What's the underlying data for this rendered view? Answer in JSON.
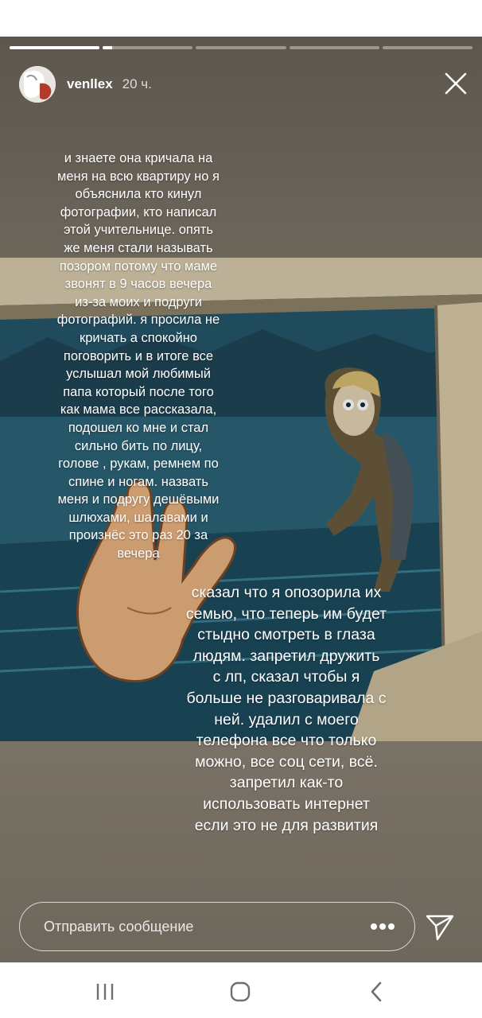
{
  "story": {
    "progress": [
      1.0,
      0.1,
      0,
      0,
      0
    ],
    "username": "venllex",
    "time": "20 ч.",
    "text_block_1": "и знаете она кричала на\nменя на всю квартиру но я\nобъяснила кто кинул\nфотографии, кто написал\nэтой учительнице. опять\nже меня стали называть\nпозором потому что маме\nзвонят в 9 часов вечера\nиз-за моих и подруги\nфотографий. я просила не\nкричать а спокойно\nпоговорить и в итоге все\nуслышал мой любимый\nпапа который после того\nкак мама все рассказала,\nподошел ко мне и стал\nсильно бить по лицу,\nголове , рукам, ремнем по\nспине и ногам. назвать\nменя и подругу дешёвыми\nшлюхами, шалавами и\nпроизнёс это раз 20 за\nвечера",
    "text_block_2": "сказал что я опозорила их\nсемью, что теперь им будет\nстыдно смотреть в глаза\nлюдям. запретил дружить\nс лп, сказал чтобы я\nбольше не разговаривала с\nней. удалил с моего\nтелефона все что только\nможно, все соц сети, всё.\nзапретил как-то\nиспользовать интернет\nесли это не для развития",
    "reply_placeholder": "Отправить сообщение",
    "icons": {
      "close": "close-icon",
      "more": "more-dots-icon",
      "send": "send-icon"
    }
  },
  "navbar": {
    "icons": [
      "recents-icon",
      "home-icon",
      "back-icon"
    ]
  },
  "colors": {
    "story_background": "#6f675c",
    "text": "#ffffff",
    "navbar": "#ffffff"
  }
}
